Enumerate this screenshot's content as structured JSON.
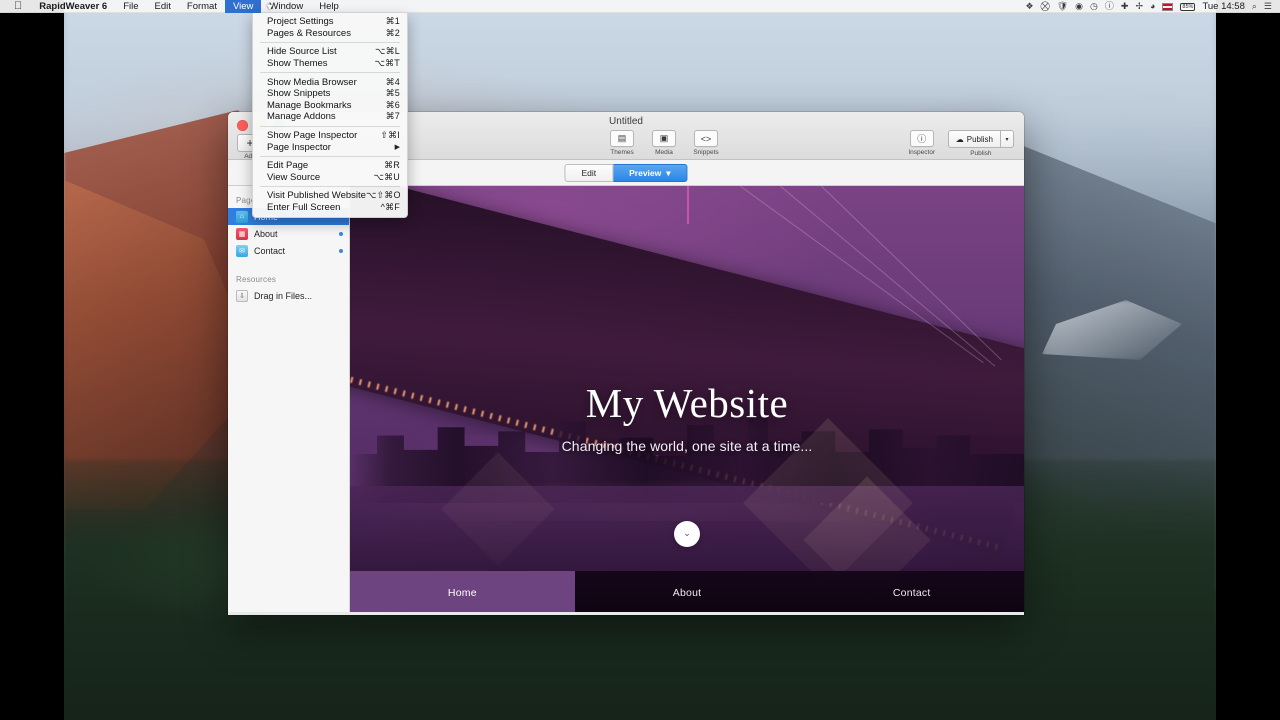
{
  "menubar": {
    "apple_icon": "apple-logo",
    "items": [
      {
        "label": "RapidWeaver 6",
        "bold": true,
        "active": false
      },
      {
        "label": "File",
        "bold": false,
        "active": false
      },
      {
        "label": "Edit",
        "bold": false,
        "active": false
      },
      {
        "label": "Format",
        "bold": false,
        "active": false
      },
      {
        "label": "View",
        "bold": false,
        "active": true
      },
      {
        "label": "Window",
        "bold": false,
        "active": false
      },
      {
        "label": "Help",
        "bold": false,
        "active": false
      }
    ],
    "status_icons": [
      "dropbox-icon",
      "no-entry-icon",
      "shield-icon",
      "eye-icon",
      "clock-icon",
      "info-icon",
      "plus-cross-icon",
      "move-icon",
      "wifi-icon"
    ],
    "flag_icon": "uk-flag-icon",
    "battery_label": "85%",
    "time": "Tue 14:58",
    "search_icon": "search-icon",
    "notification_icon": "notification-center-icon"
  },
  "view_menu": {
    "groups": [
      [
        {
          "label": "Project Settings",
          "shortcut": "⌘1",
          "submenu": false
        },
        {
          "label": "Pages & Resources",
          "shortcut": "⌘2",
          "submenu": false
        }
      ],
      [
        {
          "label": "Hide Source List",
          "shortcut": "⌥⌘L",
          "submenu": false
        },
        {
          "label": "Show Themes",
          "shortcut": "⌥⌘T",
          "submenu": false
        }
      ],
      [
        {
          "label": "Show Media Browser",
          "shortcut": "⌘4",
          "submenu": false
        },
        {
          "label": "Show Snippets",
          "shortcut": "⌘5",
          "submenu": false
        },
        {
          "label": "Manage Bookmarks",
          "shortcut": "⌘6",
          "submenu": false
        },
        {
          "label": "Manage Addons",
          "shortcut": "⌘7",
          "submenu": false
        }
      ],
      [
        {
          "label": "Show Page Inspector",
          "shortcut": "⇧⌘I",
          "submenu": false
        },
        {
          "label": "Page Inspector",
          "shortcut": "",
          "submenu": true
        }
      ],
      [
        {
          "label": "Edit Page",
          "shortcut": "⌘R",
          "submenu": false
        },
        {
          "label": "View Source",
          "shortcut": "⌥⌘U",
          "submenu": false
        }
      ],
      [
        {
          "label": "Visit Published Website",
          "shortcut": "⌥⇧⌘O",
          "submenu": false
        },
        {
          "label": "Enter Full Screen",
          "shortcut": "^⌘F",
          "submenu": false
        }
      ]
    ]
  },
  "window": {
    "title": "Untitled",
    "add_button": {
      "glyph": "+",
      "label": "Add"
    },
    "toolbar_center": [
      {
        "label": "Themes",
        "icon": "themes-icon",
        "glyph": "ᵝ"
      },
      {
        "label": "Media",
        "icon": "media-icon",
        "glyph": "▣"
      },
      {
        "label": "Snippets",
        "icon": "snippets-icon",
        "glyph": "<>"
      }
    ],
    "toolbar_right": {
      "inspector": {
        "label": "Inspector",
        "icon": "inspector-icon",
        "glyph": "ⓘ"
      },
      "publish": {
        "label": "Publish",
        "button_text": "Publish",
        "icon": "publish-icon",
        "dropdown_glyph": "▾"
      }
    },
    "mode_toggle": {
      "edit_label": "Edit",
      "preview_label": "Preview",
      "preview_arrow": "▾",
      "active": "Preview"
    }
  },
  "sidebar": {
    "pages_header": "Pages",
    "pages": [
      {
        "label": "Home",
        "icon": "home-page-icon",
        "selected": true,
        "dot": false
      },
      {
        "label": "About",
        "icon": "about-page-icon",
        "selected": false,
        "dot": true
      },
      {
        "label": "Contact",
        "icon": "contact-page-icon",
        "selected": false,
        "dot": true
      }
    ],
    "resources_header": "Resources",
    "drag_in_files": {
      "label": "Drag in Files...",
      "icon": "drag-files-icon",
      "glyph": "⬇"
    }
  },
  "preview": {
    "hero_title": "My Website",
    "hero_subtitle": "Changing the world, one site at a time...",
    "scroll_button_icon": "chevron-down-icon",
    "scroll_button_glyph": "⌄",
    "nav": [
      {
        "label": "Home",
        "active": true
      },
      {
        "label": "About",
        "active": false
      },
      {
        "label": "Contact",
        "active": false
      }
    ]
  },
  "colors": {
    "accent_blue": "#2f7ee0",
    "nav_active_purple": "#6e4480",
    "menu_highlight": "#2f6fd0"
  }
}
